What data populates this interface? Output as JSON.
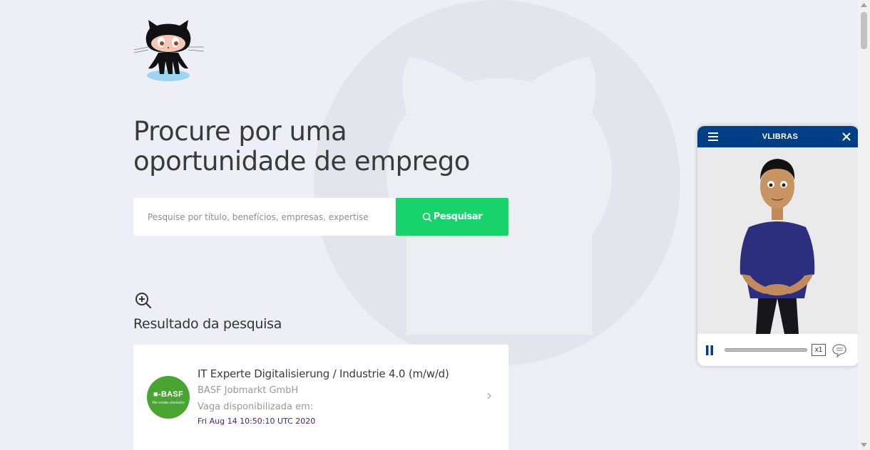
{
  "hero": {
    "headline_line1": "Procure por uma",
    "headline_line2": "oportunidade de emprego"
  },
  "search": {
    "placeholder": "Pesquise por título, benefícios, empresas, expertise",
    "value": "",
    "button_label": "Pesquisar"
  },
  "results": {
    "title": "Resultado da pesquisa",
    "jobs": [
      {
        "title": "IT Experte Digitalisierung / Industrie 4.0 (m/w/d)",
        "company": "BASF Jobmarkt GmbH",
        "availability_label": "Vaga disponibilizada em:",
        "date": "Fri Aug 14 10:50:10 UTC 2020",
        "logo_text": "BASF",
        "logo_tagline": "We create chemistry"
      }
    ]
  },
  "vlibras": {
    "title": "VLIBRAS",
    "speed": "x1"
  },
  "colors": {
    "background": "#eeeef6",
    "accent_green": "#18d26b",
    "vlibras_blue": "#003f86",
    "date_purple": "#4b2376",
    "basf_green": "#4aa431"
  },
  "icons": [
    "octocat-logo",
    "search-icon",
    "zoom-in-icon",
    "chevron-right-icon",
    "menu-icon",
    "close-icon",
    "pause-icon",
    "chat-icon"
  ]
}
